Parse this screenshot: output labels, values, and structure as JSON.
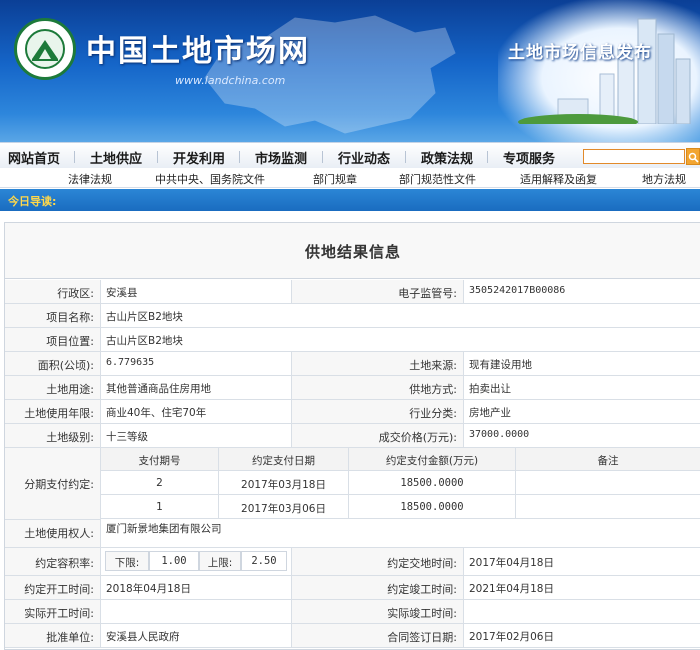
{
  "header": {
    "site_name": "中国土地市场网",
    "site_url": "www.landchina.com",
    "slogan": "土地市场信息发布"
  },
  "colors": {
    "banner_blue": "#1565c8",
    "guide_bar": "#1a6cc0",
    "guide_label": "#ffd84a",
    "search_accent": "#f2a531"
  },
  "main_nav": {
    "items": [
      "网站首页",
      "土地供应",
      "开发利用",
      "市场监测",
      "行业动态",
      "政策法规",
      "专项服务"
    ],
    "search_placeholder": ""
  },
  "sub_nav": {
    "items": [
      "法律法规",
      "中共中央、国务院文件",
      "部门规章",
      "部门规范性文件",
      "适用解释及函复",
      "地方法规"
    ]
  },
  "guide": {
    "label": "今日导读:"
  },
  "page": {
    "title": "供地结果信息"
  },
  "record": {
    "district_label": "行政区:",
    "district": "安溪县",
    "supervision_no_label": "电子监管号:",
    "supervision_no": "3505242017B00086",
    "project_name_label": "项目名称:",
    "project_name": "古山片区B2地块",
    "project_location_label": "项目位置:",
    "project_location": "古山片区B2地块",
    "area_label": "面积(公顷):",
    "area": "6.779635",
    "land_source_label": "土地来源:",
    "land_source": "现有建设用地",
    "land_use_label": "土地用途:",
    "land_use": "其他普通商品住房用地",
    "supply_method_label": "供地方式:",
    "supply_method": "拍卖出让",
    "use_years_label": "土地使用年限:",
    "use_years": "商业40年、住宅70年",
    "industry_label": "行业分类:",
    "industry": "房地产业",
    "land_grade_label": "土地级别:",
    "land_grade": "十三等级",
    "price_label": "成交价格(万元):",
    "price": "37000.0000",
    "installments_label": "分期支付约定:",
    "installment_headers": [
      "支付期号",
      "约定支付日期",
      "约定支付金额(万元)",
      "备注"
    ],
    "installments": [
      {
        "no": "2",
        "date": "2017年03月18日",
        "amount": "18500.0000",
        "note": ""
      },
      {
        "no": "1",
        "date": "2017年03月06日",
        "amount": "18500.0000",
        "note": ""
      }
    ],
    "land_user_label": "土地使用权人:",
    "land_user": "厦门新景地集团有限公司",
    "far_label": "约定容积率:",
    "far_lower_label": "下限:",
    "far_lower": "1.00",
    "far_upper_label": "上限:",
    "far_upper": "2.50",
    "delivery_label": "约定交地时间:",
    "delivery": "2017年04月18日",
    "start_label": "约定开工时间:",
    "start": "2018年04月18日",
    "finish_label": "约定竣工时间:",
    "finish": "2021年04月18日",
    "actual_start_label": "实际开工时间:",
    "actual_start": "",
    "actual_finish_label": "实际竣工时间:",
    "actual_finish": "",
    "approver_label": "批准单位:",
    "approver": "安溪县人民政府",
    "contract_label": "合同签订日期:",
    "contract": "2017年02月06日"
  }
}
